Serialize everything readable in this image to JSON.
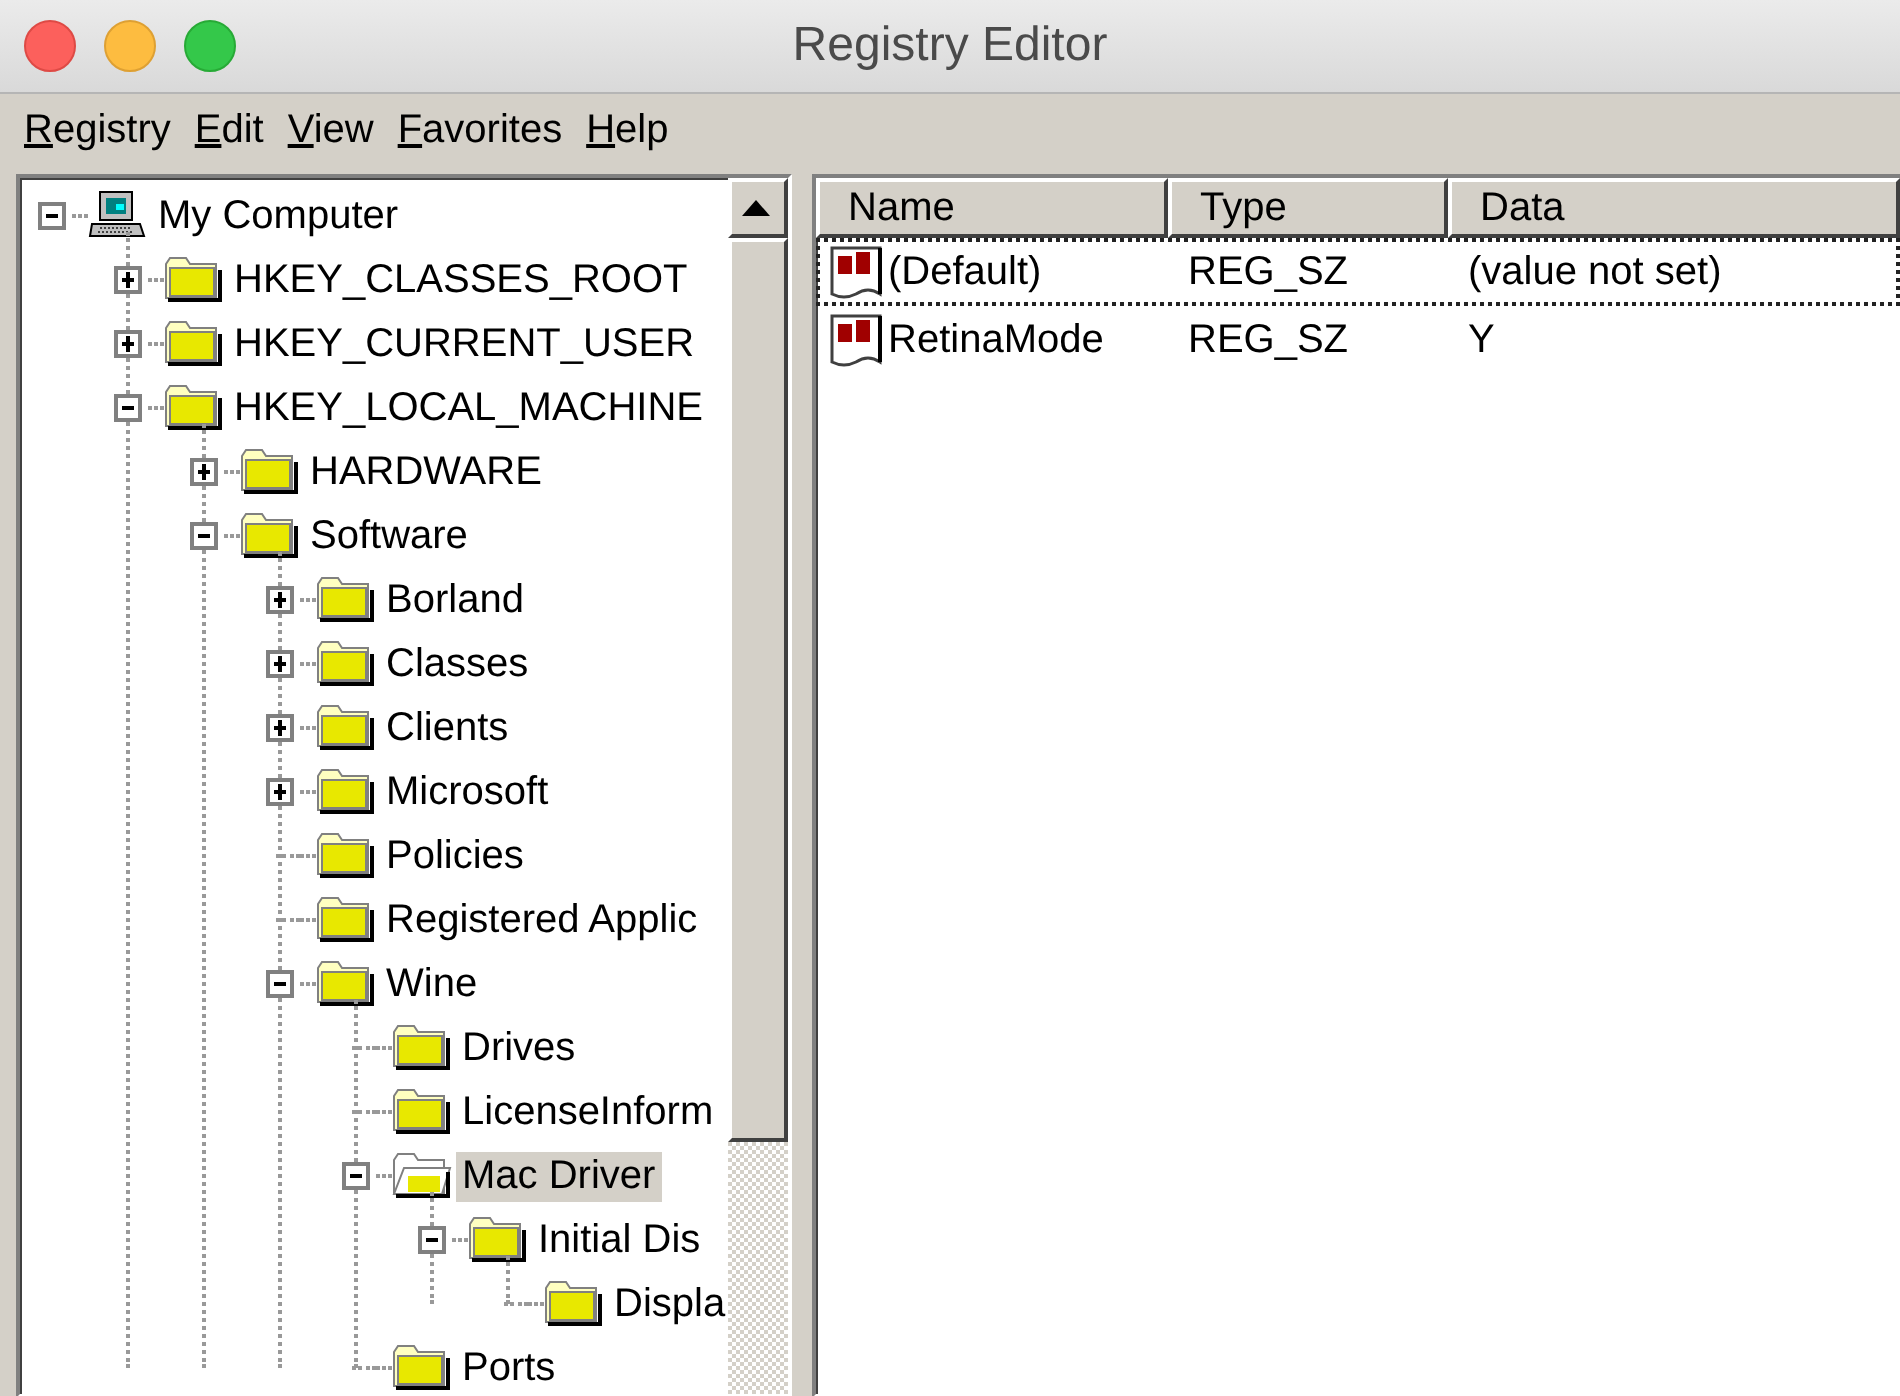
{
  "window": {
    "title": "Registry Editor"
  },
  "menu": [
    "Registry",
    "Edit",
    "View",
    "Favorites",
    "Help"
  ],
  "tree": [
    {
      "label": "My Computer",
      "kind": "computer",
      "expanded": true,
      "selected": false,
      "children": [
        {
          "label": "HKEY_CLASSES_ROOT",
          "kind": "folder",
          "expanded": false,
          "selected": false
        },
        {
          "label": "HKEY_CURRENT_USER",
          "kind": "folder",
          "expanded": false,
          "selected": false
        },
        {
          "label": "HKEY_LOCAL_MACHINE",
          "kind": "folder",
          "expanded": true,
          "selected": false,
          "children": [
            {
              "label": "HARDWARE",
              "kind": "folder",
              "expanded": false,
              "selected": false
            },
            {
              "label": "Software",
              "kind": "folder",
              "expanded": true,
              "selected": false,
              "children": [
                {
                  "label": "Borland",
                  "kind": "folder",
                  "expanded": false,
                  "selected": false
                },
                {
                  "label": "Classes",
                  "kind": "folder",
                  "expanded": false,
                  "selected": false
                },
                {
                  "label": "Clients",
                  "kind": "folder",
                  "expanded": false,
                  "selected": false
                },
                {
                  "label": "Microsoft",
                  "kind": "folder",
                  "expanded": false,
                  "selected": false
                },
                {
                  "label": "Policies",
                  "kind": "folder",
                  "selected": false
                },
                {
                  "label": "Registered Applic",
                  "kind": "folder",
                  "selected": false
                },
                {
                  "label": "Wine",
                  "kind": "folder",
                  "expanded": true,
                  "selected": false,
                  "children": [
                    {
                      "label": "Drives",
                      "kind": "folder",
                      "selected": false
                    },
                    {
                      "label": "LicenseInform",
                      "kind": "folder",
                      "selected": false
                    },
                    {
                      "label": "Mac Driver",
                      "kind": "folder-open",
                      "expanded": true,
                      "selected": true,
                      "children": [
                        {
                          "label": "Initial Dis",
                          "kind": "folder",
                          "expanded": true,
                          "selected": false,
                          "children": [
                            {
                              "label": "Displa",
                              "kind": "folder",
                              "selected": false
                            }
                          ]
                        }
                      ]
                    },
                    {
                      "label": "Ports",
                      "kind": "folder",
                      "selected": false
                    }
                  ]
                }
              ]
            }
          ]
        }
      ]
    }
  ],
  "list": {
    "columns": [
      "Name",
      "Type",
      "Data"
    ],
    "rows": [
      {
        "name": "(Default)",
        "type": "REG_SZ",
        "data": "(value not set)",
        "focused": true
      },
      {
        "name": "RetinaMode",
        "type": "REG_SZ",
        "data": "Y",
        "focused": false
      }
    ]
  }
}
